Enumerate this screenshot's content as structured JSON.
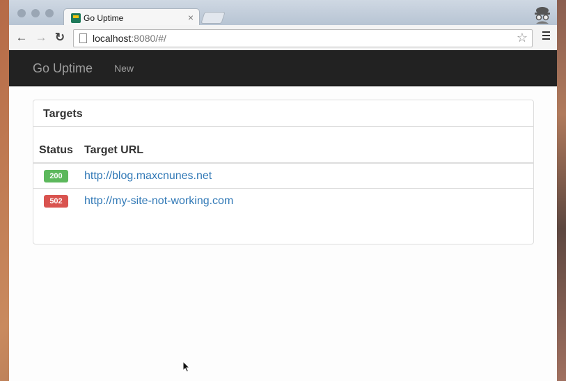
{
  "browser": {
    "tab_title": "Go Uptime",
    "tab_close": "×",
    "url_host": "localhost",
    "url_path": ":8080/#/",
    "back": "←",
    "forward": "→",
    "reload": "↻",
    "star": "☆"
  },
  "navbar": {
    "brand": "Go Uptime",
    "links": [
      "New"
    ]
  },
  "panel": {
    "title": "Targets",
    "columns": [
      "Status",
      "Target URL"
    ],
    "rows": [
      {
        "status": "200",
        "url": "http://blog.maxcnunes.net",
        "color": "#5cb85c"
      },
      {
        "status": "502",
        "url": "http://my-site-not-working.com",
        "color": "#d9534f"
      }
    ]
  },
  "colors": {
    "navbar_bg": "#222222",
    "link": "#337ab7",
    "ok": "#5cb85c",
    "error": "#d9534f"
  }
}
